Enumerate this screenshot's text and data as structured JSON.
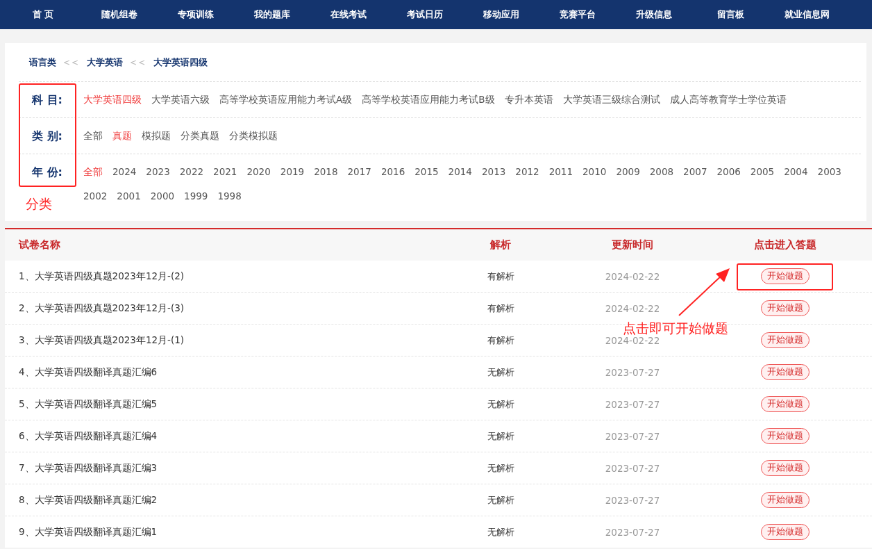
{
  "nav": [
    "首 页",
    "随机组卷",
    "专项训练",
    "我的题库",
    "在线考试",
    "考试日历",
    "移动应用",
    "竞赛平台",
    "升级信息",
    "留言板",
    "就业信息网"
  ],
  "breadcrumb": [
    "语言类",
    "大学英语",
    "大学英语四级"
  ],
  "breadcrumb_separator": "<<",
  "filters": [
    {
      "label": "科 目:",
      "options": [
        {
          "text": "大学英语四级",
          "selected": true
        },
        {
          "text": "大学英语六级",
          "selected": false
        },
        {
          "text": "高等学校英语应用能力考试A级",
          "selected": false
        },
        {
          "text": "高等学校英语应用能力考试B级",
          "selected": false
        },
        {
          "text": "专升本英语",
          "selected": false
        },
        {
          "text": "大学英语三级综合测试",
          "selected": false
        },
        {
          "text": "成人高等教育学士学位英语",
          "selected": false
        }
      ]
    },
    {
      "label": "类 别:",
      "options": [
        {
          "text": "全部",
          "selected": false
        },
        {
          "text": "真题",
          "selected": true
        },
        {
          "text": "模拟题",
          "selected": false
        },
        {
          "text": "分类真题",
          "selected": false
        },
        {
          "text": "分类模拟题",
          "selected": false
        }
      ]
    },
    {
      "label": "年 份:",
      "options": [
        {
          "text": "全部",
          "selected": true
        },
        {
          "text": "2024",
          "selected": false
        },
        {
          "text": "2023",
          "selected": false
        },
        {
          "text": "2022",
          "selected": false
        },
        {
          "text": "2021",
          "selected": false
        },
        {
          "text": "2020",
          "selected": false
        },
        {
          "text": "2019",
          "selected": false
        },
        {
          "text": "2018",
          "selected": false
        },
        {
          "text": "2017",
          "selected": false
        },
        {
          "text": "2016",
          "selected": false
        },
        {
          "text": "2015",
          "selected": false
        },
        {
          "text": "2014",
          "selected": false
        },
        {
          "text": "2013",
          "selected": false
        },
        {
          "text": "2012",
          "selected": false
        },
        {
          "text": "2011",
          "selected": false
        },
        {
          "text": "2010",
          "selected": false
        },
        {
          "text": "2009",
          "selected": false
        },
        {
          "text": "2008",
          "selected": false
        },
        {
          "text": "2007",
          "selected": false
        },
        {
          "text": "2006",
          "selected": false
        },
        {
          "text": "2005",
          "selected": false
        },
        {
          "text": "2004",
          "selected": false
        },
        {
          "text": "2003",
          "selected": false
        },
        {
          "text": "2002",
          "selected": false
        },
        {
          "text": "2001",
          "selected": false
        },
        {
          "text": "2000",
          "selected": false
        },
        {
          "text": "1999",
          "selected": false
        },
        {
          "text": "1998",
          "selected": false
        }
      ]
    }
  ],
  "table": {
    "columns": [
      "试卷名称",
      "解析",
      "更新时间",
      "点击进入答题"
    ],
    "rows": [
      {
        "name": "1、大学英语四级真题2023年12月-(2)",
        "analysis": "有解析",
        "date": "2024-02-22",
        "action": "开始做题"
      },
      {
        "name": "2、大学英语四级真题2023年12月-(3)",
        "analysis": "有解析",
        "date": "2024-02-22",
        "action": "开始做题"
      },
      {
        "name": "3、大学英语四级真题2023年12月-(1)",
        "analysis": "有解析",
        "date": "2024-02-22",
        "action": "开始做题"
      },
      {
        "name": "4、大学英语四级翻译真题汇编6",
        "analysis": "无解析",
        "date": "2023-07-27",
        "action": "开始做题"
      },
      {
        "name": "5、大学英语四级翻译真题汇编5",
        "analysis": "无解析",
        "date": "2023-07-27",
        "action": "开始做题"
      },
      {
        "name": "6、大学英语四级翻译真题汇编4",
        "analysis": "无解析",
        "date": "2023-07-27",
        "action": "开始做题"
      },
      {
        "name": "7、大学英语四级翻译真题汇编3",
        "analysis": "无解析",
        "date": "2023-07-27",
        "action": "开始做题"
      },
      {
        "name": "8、大学英语四级翻译真题汇编2",
        "analysis": "无解析",
        "date": "2023-07-27",
        "action": "开始做题"
      },
      {
        "name": "9、大学英语四级翻译真题汇编1",
        "analysis": "无解析",
        "date": "2023-07-27",
        "action": "开始做题"
      }
    ]
  },
  "annotations": {
    "filter_note": "分类",
    "button_note": "点击即可开始做题"
  }
}
